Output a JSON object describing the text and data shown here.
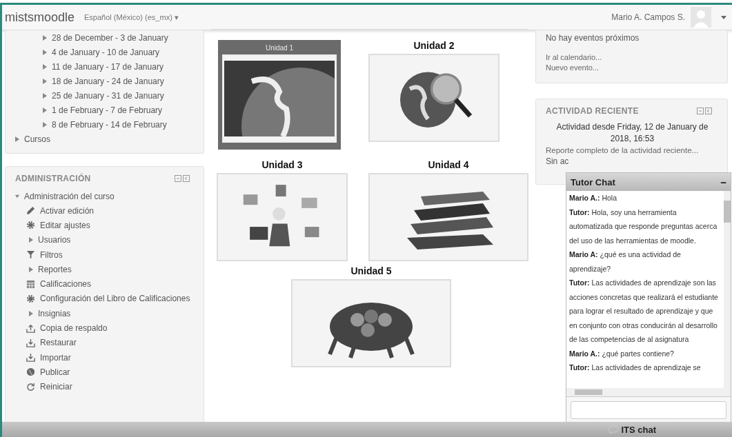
{
  "header": {
    "brand": "mistsmoodle",
    "language": "Español (México) (es_mx)",
    "language_caret": "▾",
    "user": "Mario A. Campos S."
  },
  "navigation": {
    "weeks": [
      {
        "label": "28 de December - 3 de January",
        "expanded": false
      },
      {
        "label": "4 de January - 10 de January",
        "expanded": false
      },
      {
        "label": "11 de January - 17 de January",
        "expanded": false
      },
      {
        "label": "18 de January - 24 de January",
        "expanded": false
      },
      {
        "label": "25 de January - 31 de January",
        "expanded": false
      },
      {
        "label": "1 de February - 7 de February",
        "expanded": false
      },
      {
        "label": "8 de February - 14 de February",
        "expanded": false
      }
    ],
    "courses": {
      "label": "Cursos",
      "expanded": false
    }
  },
  "administration": {
    "title": "ADMINISTRACIÓN",
    "section": {
      "label": "Administración del curso",
      "expanded": true
    },
    "items": [
      {
        "kind": "pencil",
        "label": "Activar edición"
      },
      {
        "kind": "gear",
        "label": "Editar ajustes"
      },
      {
        "kind": "branch",
        "label": "Usuarios"
      },
      {
        "kind": "filter",
        "label": "Filtros"
      },
      {
        "kind": "branch",
        "label": "Reportes"
      },
      {
        "kind": "table",
        "label": "Calificaciones"
      },
      {
        "kind": "gear",
        "label": "Configuración del Libro de Calificaciones"
      },
      {
        "kind": "branch",
        "label": "Insignias"
      },
      {
        "kind": "upload",
        "label": "Copia de respaldo"
      },
      {
        "kind": "download",
        "label": "Restaurar"
      },
      {
        "kind": "download",
        "label": "Importar"
      },
      {
        "kind": "globe",
        "label": "Publicar"
      },
      {
        "kind": "reload",
        "label": "Reiniciar"
      }
    ]
  },
  "units": [
    {
      "title": "Unidad 1",
      "selected": true,
      "kind": "globe"
    },
    {
      "title": "Unidad 2",
      "selected": false,
      "kind": "search-globe"
    },
    {
      "title": "Unidad 3",
      "selected": false,
      "kind": "people"
    },
    {
      "title": "Unidad 4",
      "selected": false,
      "kind": "books"
    },
    {
      "title": "Unidad 5",
      "selected": false,
      "kind": "network"
    }
  ],
  "events": {
    "empty": "No hay eventos próximos",
    "links": [
      "Ir al calendario...",
      "Nuevo evento..."
    ]
  },
  "recent_activity": {
    "title": "ACTIVIDAD RECIENTE",
    "since": "Actividad desde Friday, 12 de January de 2018, 16:53",
    "report_link": "Reporte completo de la actividad reciente...",
    "none": "Sin ac"
  },
  "tutor_chat": {
    "title": "Tutor Chat",
    "collapse": "−",
    "messages": [
      {
        "author": "Mario A.:",
        "text": "Hola"
      },
      {
        "author": "Tutor:",
        "text": "Hola, soy una herramienta automatizada que responde preguntas acerca del uso de las herramientas de moodle."
      },
      {
        "author": "Mario A:",
        "text": "¿qué es una actividad de aprendizaje?"
      },
      {
        "author": "Tutor:",
        "text": "Las actividades de aprendizaje son las acciones concretas que realizará el estudiante para lograr el resultado de aprendizaje y que en conjunto con otras conducirán al desarrollo de las competencias de al asignatura"
      },
      {
        "author": "Mario A.:",
        "text": "¿qué partes contiene?"
      },
      {
        "author": "Tutor:",
        "text": "Las actividades de aprendizaje se"
      }
    ]
  },
  "footer": {
    "chat_label": "ITS chat"
  }
}
